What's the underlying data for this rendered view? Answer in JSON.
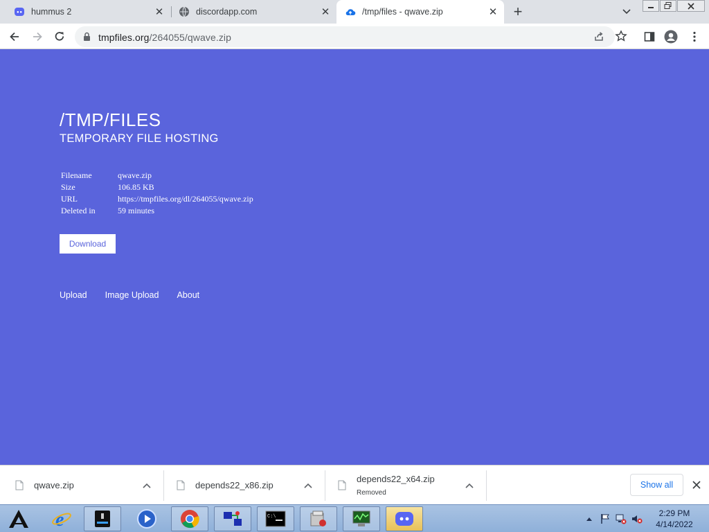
{
  "browser": {
    "tabs": [
      {
        "title": "hummus 2",
        "icon": "discord-icon"
      },
      {
        "title": "discordapp.com",
        "icon": "globe-icon"
      },
      {
        "title": "/tmp/files - qwave.zip",
        "icon": "cloud-upload-icon"
      }
    ],
    "active_tab": 2,
    "address": {
      "host": "tmpfiles.org",
      "path": "/264055/qwave.zip"
    }
  },
  "page": {
    "title": "/TMP/FILES",
    "subtitle": "TEMPORARY FILE HOSTING",
    "file_info": [
      {
        "key": "Filename",
        "value": "qwave.zip"
      },
      {
        "key": "Size",
        "value": "106.85 KB"
      },
      {
        "key": "URL",
        "value": "https://tmpfiles.org/dl/264055/qwave.zip"
      },
      {
        "key": "Deleted in",
        "value": "59 minutes"
      }
    ],
    "download_label": "Download",
    "footer_links": [
      "Upload",
      "Image Upload",
      "About"
    ]
  },
  "downloads_bar": {
    "items": [
      {
        "name": "qwave.zip",
        "status": ""
      },
      {
        "name": "depends22_x86.zip",
        "status": ""
      },
      {
        "name": "depends22_x64.zip",
        "status": "Removed"
      }
    ],
    "show_all_label": "Show all"
  },
  "taskbar": {
    "time": "2:29 PM",
    "date": "4/14/2022"
  },
  "colors": {
    "page_background": "#5a64dc",
    "link_blue": "#1a73e8"
  }
}
